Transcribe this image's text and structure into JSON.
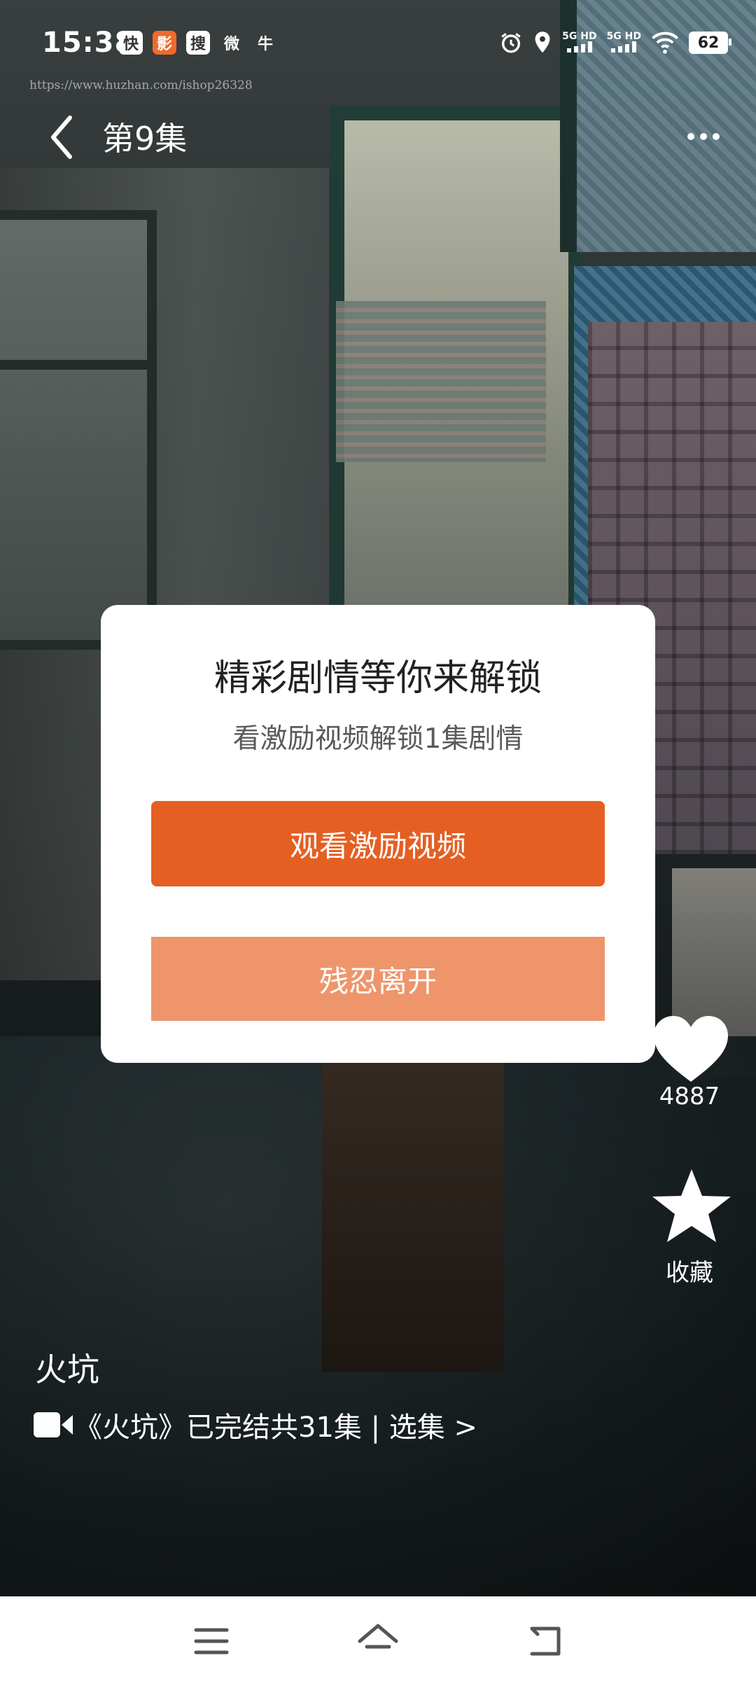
{
  "status_bar": {
    "time": "15:38",
    "app_icons": [
      "快",
      "影",
      "搜",
      "微",
      "牛"
    ],
    "battery": "62",
    "signal_labels": [
      "5G HD",
      "5G HD"
    ]
  },
  "watermark_url": "https://www.huzhan.com/ishop26328",
  "header": {
    "episode_title": "第9集"
  },
  "modal": {
    "title": "精彩剧情等你来解锁",
    "subtitle": "看激励视频解锁1集剧情",
    "primary_button": "观看激励视频",
    "secondary_button": "残忍离开",
    "primary_color": "#e55f22",
    "secondary_color": "#ee956b"
  },
  "actions": {
    "like_count": "4887",
    "favorite_label": "收藏"
  },
  "drama": {
    "title": "火坑",
    "meta": "《火坑》已完结共31集 | 选集 >"
  },
  "icons": {
    "back": "back-arrow-icon",
    "more": "more-dots-icon",
    "like": "heart-icon",
    "favorite": "star-icon",
    "video": "video-camera-icon",
    "nav": [
      "menu-icon",
      "home-icon",
      "back-icon"
    ]
  }
}
